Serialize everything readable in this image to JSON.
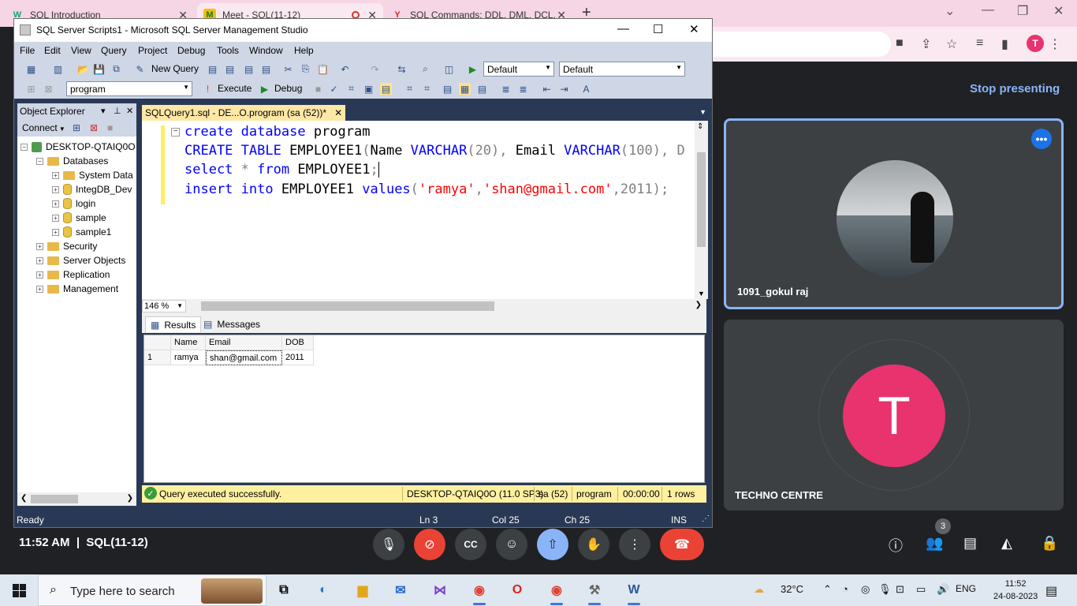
{
  "chrome": {
    "tabs": [
      {
        "title": "SQL Introduction",
        "favicon": "W"
      },
      {
        "title": "Meet - SQL(11-12)",
        "favicon": "M"
      },
      {
        "title": "SQL Commands: DDL, DML, DCL,",
        "favicon": "Y"
      }
    ],
    "profile_initial": "T"
  },
  "ssms": {
    "title": "SQL Server Scripts1 - Microsoft SQL Server Management Studio",
    "menu": [
      "File",
      "Edit",
      "View",
      "Query",
      "Project",
      "Debug",
      "Tools",
      "Window",
      "Help"
    ],
    "toolbar1": {
      "new_query": "New Query",
      "combo1": "Default",
      "combo2": "Default"
    },
    "toolbar2": {
      "database": "program",
      "execute": "Execute",
      "debug": "Debug"
    },
    "object_explorer": {
      "title": "Object Explorer",
      "connect": "Connect",
      "tree": [
        {
          "label": "DESKTOP-QTAIQ0O",
          "level": 0,
          "type": "server",
          "expanded": true
        },
        {
          "label": "Databases",
          "level": 1,
          "type": "folder",
          "expanded": true
        },
        {
          "label": "System Data",
          "level": 2,
          "type": "folder",
          "expanded": false
        },
        {
          "label": "IntegDB_Dev",
          "level": 2,
          "type": "db",
          "expanded": false
        },
        {
          "label": "login",
          "level": 2,
          "type": "db",
          "expanded": false
        },
        {
          "label": "sample",
          "level": 2,
          "type": "db",
          "expanded": false
        },
        {
          "label": "sample1",
          "level": 2,
          "type": "db",
          "expanded": false
        },
        {
          "label": "Security",
          "level": 1,
          "type": "folder",
          "expanded": false
        },
        {
          "label": "Server Objects",
          "level": 1,
          "type": "folder",
          "expanded": false
        },
        {
          "label": "Replication",
          "level": 1,
          "type": "folder",
          "expanded": false
        },
        {
          "label": "Management",
          "level": 1,
          "type": "folder",
          "expanded": false
        }
      ]
    },
    "doc_tab": "SQLQuery1.sql - DE...O.program (sa (52))*",
    "code": {
      "line1": {
        "kw1": "create",
        "kw2": "database",
        "rest": "program"
      },
      "line2": {
        "kw1": "CREATE",
        "kw2": "TABLE",
        "t1": "EMPLOYEE1",
        "t2": "(",
        "t3": "Name ",
        "k3": "VARCHAR",
        "t4": "(20), ",
        "t5": "Email ",
        "k4": "VARCHAR",
        "t6": "(100), D"
      },
      "line3": {
        "kw1": "select",
        "op": "*",
        "kw2": "from",
        "rest": "EMPLOYEE1",
        "semi": ";"
      },
      "line4": {
        "kw1": "insert",
        "kw2": "into",
        "t1": "EMPLOYEE1",
        "kw3": "values",
        "p1": "(",
        "s1": "'ramya'",
        "c1": ",",
        "s2": "'shan@gmail.com'",
        "c2": ",2011",
        "p2": ");"
      }
    },
    "zoom": "146 %",
    "results_tabs": [
      "Results",
      "Messages"
    ],
    "results": {
      "columns": [
        "Name",
        "Email",
        "DOB"
      ],
      "rows": [
        {
          "num": "1",
          "Name": "ramya",
          "Email": "shan@gmail.com",
          "DOB": "2011"
        }
      ]
    },
    "query_status": {
      "message": "Query executed successfully.",
      "server": "DESKTOP-QTAIQ0O (11.0 SP3)",
      "user": "sa (52)",
      "db": "program",
      "time": "00:00:00",
      "rows": "1 rows"
    },
    "statusbar": {
      "left": "Ready",
      "ln": "Ln 3",
      "col": "Col 25",
      "ch": "Ch 25",
      "mode": "INS"
    }
  },
  "meet": {
    "stop_presenting": "Stop presenting",
    "participant1": "1091_gokul raj",
    "participant2": "TECHNO CENTRE",
    "participant2_initial": "T",
    "time": "11:52 AM",
    "meeting_name": "SQL(11-12)",
    "people_count": "3"
  },
  "taskbar": {
    "search_placeholder": "Type here to search",
    "weather": "32°C",
    "lang": "ENG",
    "time": "11:52",
    "date": "24-08-2023"
  }
}
